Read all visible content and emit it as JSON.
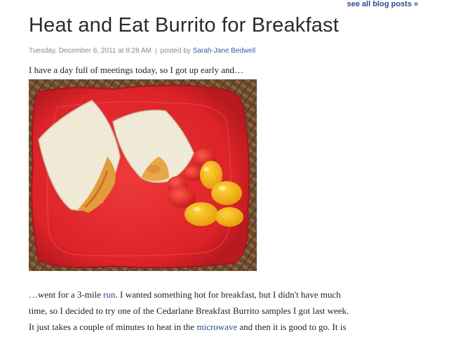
{
  "header": {
    "see_all_label": "see all blog posts »"
  },
  "post": {
    "title": "Heat and Eat Burrito for Breakfast",
    "meta": {
      "date": "Tuesday, December 6, 2011 at 8:28 AM",
      "separator": "|",
      "posted_by_prefix": "posted by",
      "author": "Sarah-Jane Bedwell"
    },
    "intro": "I have a day full of meetings today, so I got up early and…",
    "body": {
      "line1_a": "…went for a 3-mile ",
      "line1_link": "run",
      "line1_b": ". I wanted something hot for breakfast, but I didn't have much",
      "line2": "time, so I decided to try one of the Cedarlane Breakfast Burrito samples I got last week.",
      "line3_a": "It just takes a couple of minutes to heat in the ",
      "line3_link": "microwave",
      "line3_b": " and then it is good to go. It is"
    }
  },
  "colors": {
    "link": "#2d4a8a",
    "plate": "#e2262b",
    "wicker": "#6b4a2e"
  }
}
